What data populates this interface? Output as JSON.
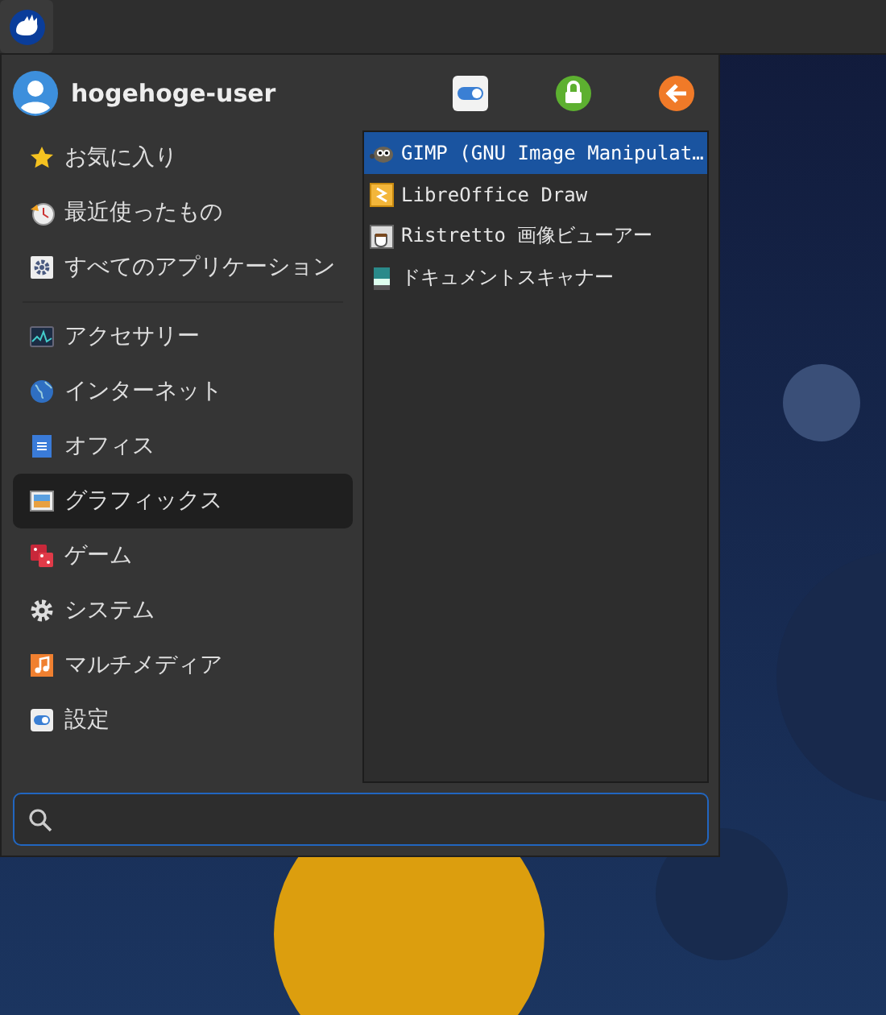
{
  "user": {
    "name": "hogehoge-user"
  },
  "sidebar": {
    "sections": [
      {
        "items": [
          {
            "label": "お気に入り",
            "selected": false
          },
          {
            "label": "最近使ったもの",
            "selected": false
          },
          {
            "label": "すべてのアプリケーション",
            "selected": false
          }
        ]
      },
      {
        "items": [
          {
            "label": "アクセサリー",
            "selected": false
          },
          {
            "label": "インターネット",
            "selected": false
          },
          {
            "label": "オフィス",
            "selected": false
          },
          {
            "label": "グラフィックス",
            "selected": true
          },
          {
            "label": "ゲーム",
            "selected": false
          },
          {
            "label": "システム",
            "selected": false
          },
          {
            "label": "マルチメディア",
            "selected": false
          },
          {
            "label": "設定",
            "selected": false
          }
        ]
      }
    ]
  },
  "apps": [
    {
      "label": "GIMP (GNU Image Manipulat…",
      "selected": true
    },
    {
      "label": "LibreOffice Draw",
      "selected": false
    },
    {
      "label": "Ristretto 画像ビューアー",
      "selected": false
    },
    {
      "label": "ドキュメントスキャナー",
      "selected": false
    }
  ]
}
